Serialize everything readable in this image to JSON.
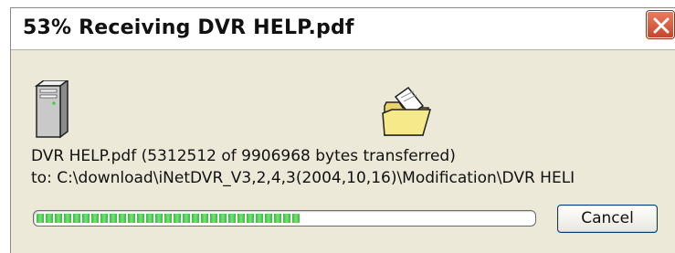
{
  "window": {
    "title": "53% Receiving DVR HELP.pdf"
  },
  "transfer": {
    "status_line": "DVR HELP.pdf (5312512 of 9906968  bytes transferred)",
    "destination_line": "to: C:\\download\\iNetDVR_V3,2,4,3(2004,10,16)\\Modification\\DVR HELI",
    "progress_fraction": 0.53
  },
  "buttons": {
    "cancel_label": "Cancel"
  },
  "icons": {
    "close": "close-icon",
    "source": "server-icon",
    "destination": "folder-icon"
  },
  "colors": {
    "progress": "#33bb44",
    "close_button": "#d9533a",
    "window_bg": "#ece9d8"
  }
}
